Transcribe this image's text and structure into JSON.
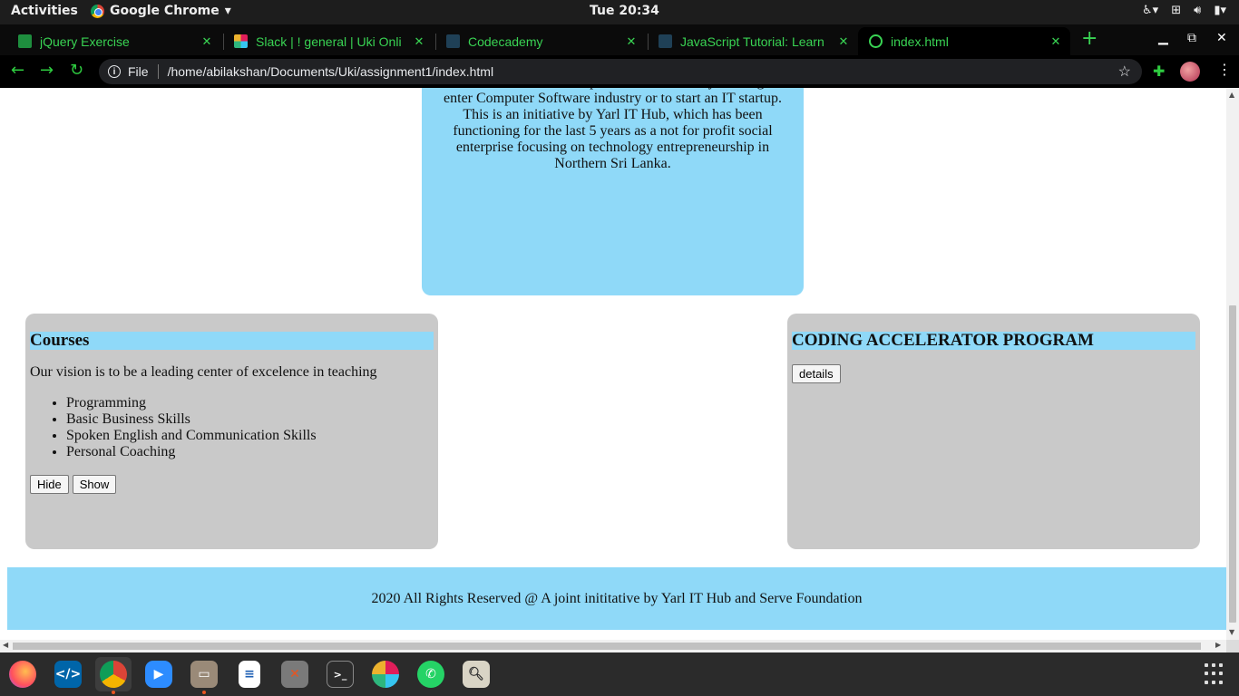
{
  "topbar": {
    "activities": "Activities",
    "app_name": "Google Chrome",
    "clock": "Tue 20:34"
  },
  "tabs": [
    {
      "title": "jQuery Exercise",
      "icon": "google-classroom-icon",
      "color": "#1e8e3e"
    },
    {
      "title": "Slack | ! general | Uki Onli",
      "icon": "slack-icon",
      "color": "#e01e5a"
    },
    {
      "title": "Codecademy",
      "icon": "codecademy-icon",
      "color": "#1f4056"
    },
    {
      "title": "JavaScript Tutorial: Learn",
      "icon": "document-icon",
      "color": "#1f4056"
    },
    {
      "title": "index.html",
      "icon": "globe-icon",
      "color": "#39d353"
    }
  ],
  "omnibox": {
    "scheme": "File",
    "url": "/home/abilakshan/Documents/Uki/assignment1/index.html"
  },
  "page": {
    "about_text": "education. It is aimed to provide the necessary training to enter Computer Software industry or to start an IT startup. This is an initiative by Yarl IT Hub, which has been functioning for the last 5 years as a not for profit social enterprise focusing on technology entrepreneurship in Northern Sri Lanka.",
    "courses": {
      "heading": "Courses",
      "vision": "Our vision is to be a leading center of excelence in teaching",
      "items": [
        "Programming",
        "Basic Business Skills",
        "Spoken English and Communication Skills",
        "Personal Coaching"
      ],
      "hide_label": "Hide",
      "show_label": "Show"
    },
    "program": {
      "heading": "CODING ACCELERATOR PROGRAM",
      "details_label": "details"
    },
    "footer": "2020 All Rights Reserved @ A joint inititative by Yarl IT Hub and Serve Foundation"
  },
  "colors": {
    "accent_blue": "#8fd9f8",
    "card_gray": "#c9c9c9",
    "chrome_green": "#39d353"
  },
  "dock": [
    {
      "name": "firefox-icon"
    },
    {
      "name": "vscode-icon"
    },
    {
      "name": "chrome-icon"
    },
    {
      "name": "zoom-icon"
    },
    {
      "name": "files-icon"
    },
    {
      "name": "text-editor-icon"
    },
    {
      "name": "settings-tool-icon"
    },
    {
      "name": "terminal-icon"
    },
    {
      "name": "slack-icon"
    },
    {
      "name": "whatsapp-icon"
    },
    {
      "name": "image-viewer-icon"
    }
  ]
}
